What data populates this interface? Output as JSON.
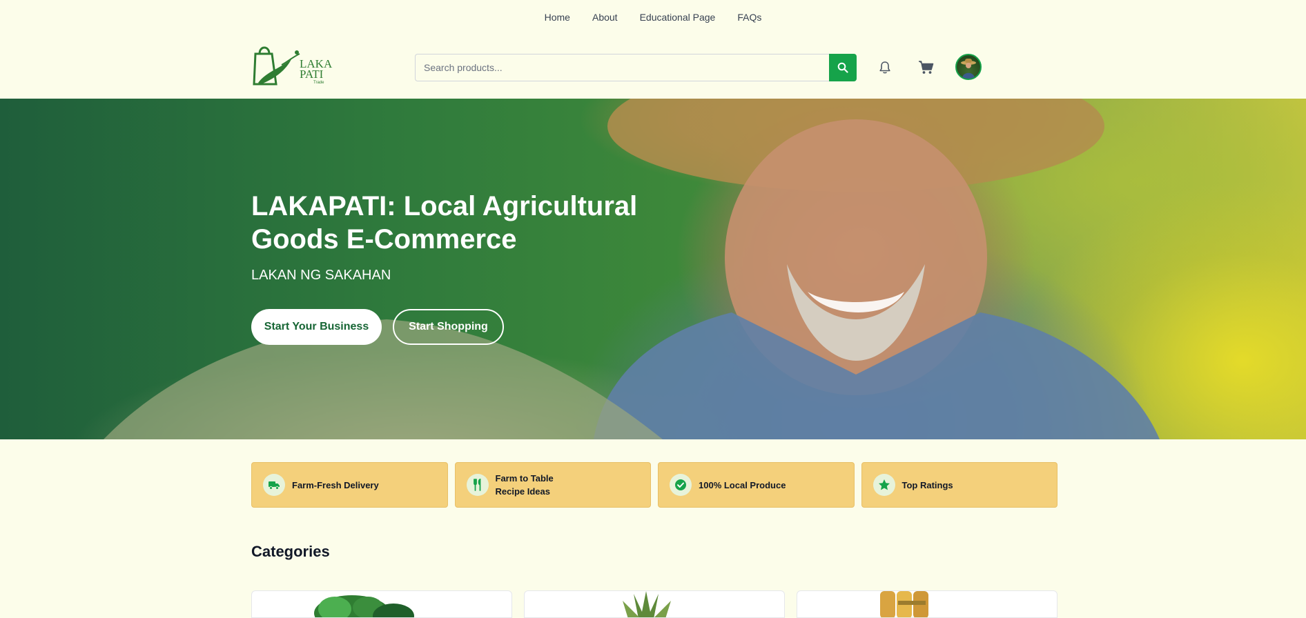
{
  "top_nav": {
    "items": [
      {
        "label": "Home"
      },
      {
        "label": "About"
      },
      {
        "label": "Educational Page"
      },
      {
        "label": "FAQs"
      }
    ]
  },
  "header": {
    "logo_text_top": "LAKA",
    "logo_text_bottom": "PATI",
    "logo_tagline": "Trade",
    "search_placeholder": "Search products...",
    "icons": [
      "search-icon",
      "bell-icon",
      "cart-icon",
      "user-avatar"
    ]
  },
  "hero": {
    "title": "LAKAPATI: Local Agricultural Goods E-Commerce",
    "subtitle": "LAKAN NG SAKAHAN",
    "primary_button": "Start Your Business",
    "secondary_button": "Start Shopping"
  },
  "features": [
    {
      "label": "Farm-Fresh Delivery",
      "icon": "truck-icon"
    },
    {
      "label": "Farm to Table\nRecipe Ideas",
      "icon": "utensils-icon"
    },
    {
      "label": "100% Local Produce",
      "icon": "check-circle-icon"
    },
    {
      "label": "Top Ratings",
      "icon": "star-icon"
    }
  ],
  "categories": {
    "title": "Categories",
    "cards": [
      {
        "icon": "leafy-greens-image"
      },
      {
        "icon": "pineapple-image"
      },
      {
        "icon": "grain-bundle-image"
      }
    ]
  },
  "colors": {
    "background": "#fcfdea",
    "accent": "#16a34a",
    "feature_bg": "#f4d07b",
    "hero_button_text": "#166534"
  }
}
